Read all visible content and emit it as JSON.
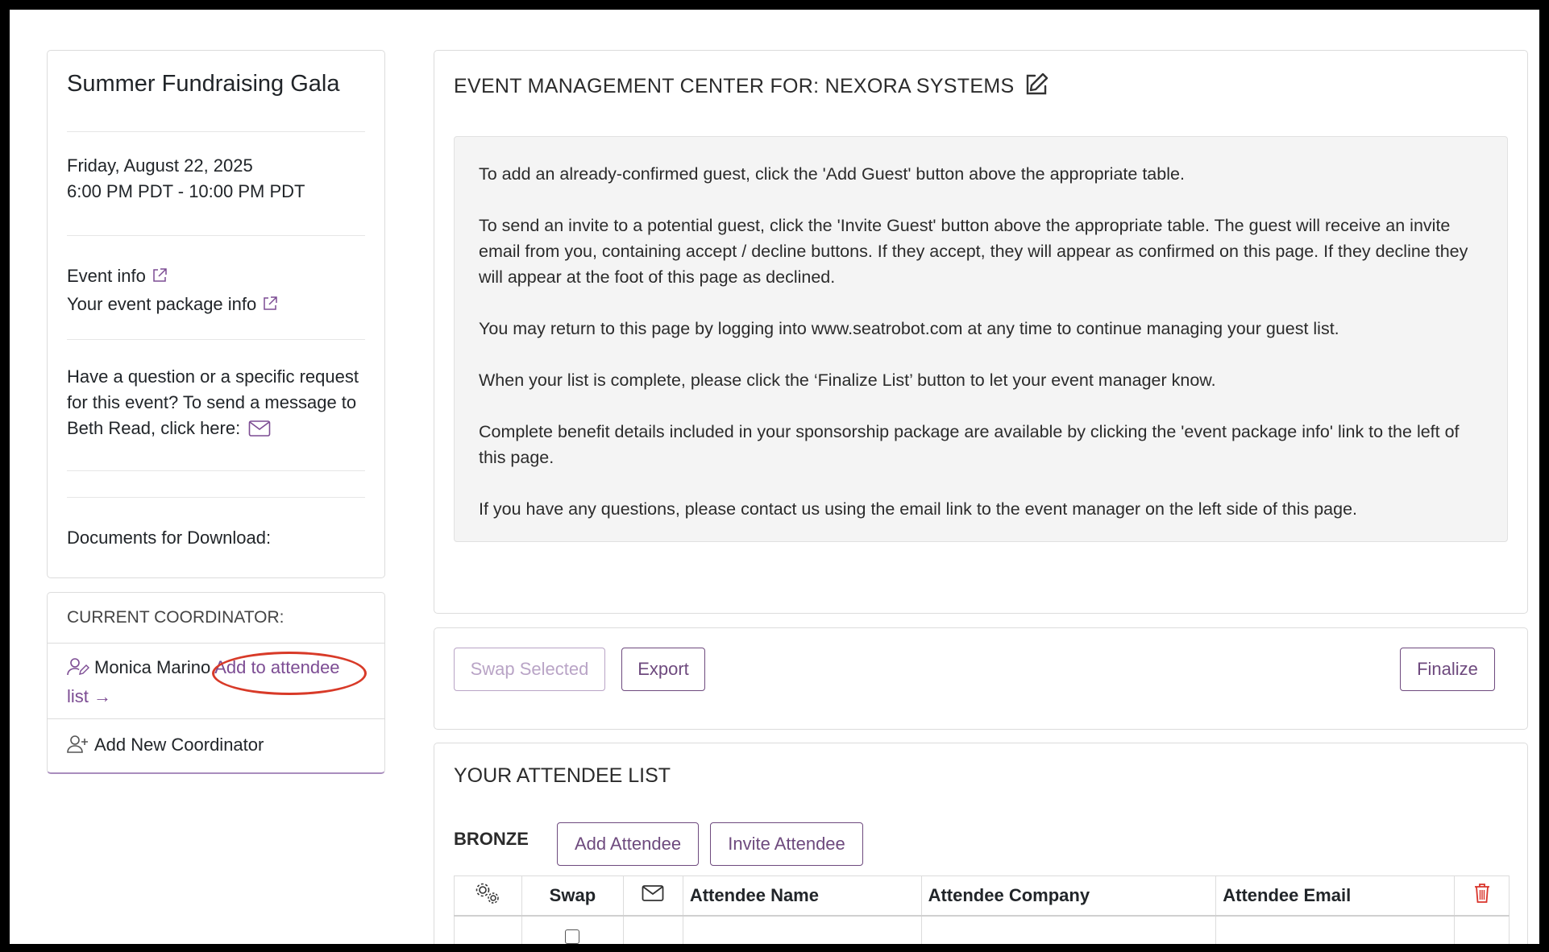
{
  "event": {
    "title": "Summer Fundraising Gala",
    "date": "Friday, August 22, 2025",
    "time": "6:00 PM PDT - 10:00 PM PDT",
    "event_info_link": "Event info",
    "package_info_link": "Your event package info",
    "question_text": "Have a question or a specific request for this event? To send a message to Beth Read, click here:",
    "documents_label": "Documents for Download:"
  },
  "coordinator": {
    "header": "CURRENT COORDINATOR:",
    "name": "Monica Marino",
    "add_link": "Add to attendee list →",
    "add_new": "Add New Coordinator"
  },
  "info": {
    "heading": "EVENT MANAGEMENT CENTER FOR: NEXORA SYSTEMS",
    "paragraphs": [
      "To add an already-confirmed guest, click the 'Add Guest' button above the appropriate table.",
      "To send an invite to a potential guest, click the 'Invite Guest' button above the appropriate table. The guest will receive an invite email from you, containing accept / decline buttons. If they accept, they will appear as confirmed on this page. If they decline they will appear at the foot of this page as declined.",
      "You may return to this page by logging into www.seatrobot.com at any time to continue managing your guest list.",
      "When your list is complete, please click the ‘Finalize List’ button to let your event manager know.",
      "Complete benefit details included in your sponsorship package are available by clicking the 'event package info' link to the left of this page.",
      "If you have any questions, please contact us using the email link to the event manager on the left side of this page."
    ]
  },
  "actions": {
    "swap_selected": "Swap Selected",
    "export": "Export",
    "finalize": "Finalize"
  },
  "attendees": {
    "heading": "YOUR ATTENDEE LIST",
    "tier": "BRONZE",
    "add_attendee": "Add Attendee",
    "invite_attendee": "Invite Attendee",
    "columns": {
      "swap": "Swap",
      "name": "Attendee Name",
      "company": "Attendee Company",
      "email": "Attendee Email"
    }
  },
  "colors": {
    "accent": "#6e4a7e",
    "annotation": "#d83a28",
    "delete": "#d9342b"
  }
}
